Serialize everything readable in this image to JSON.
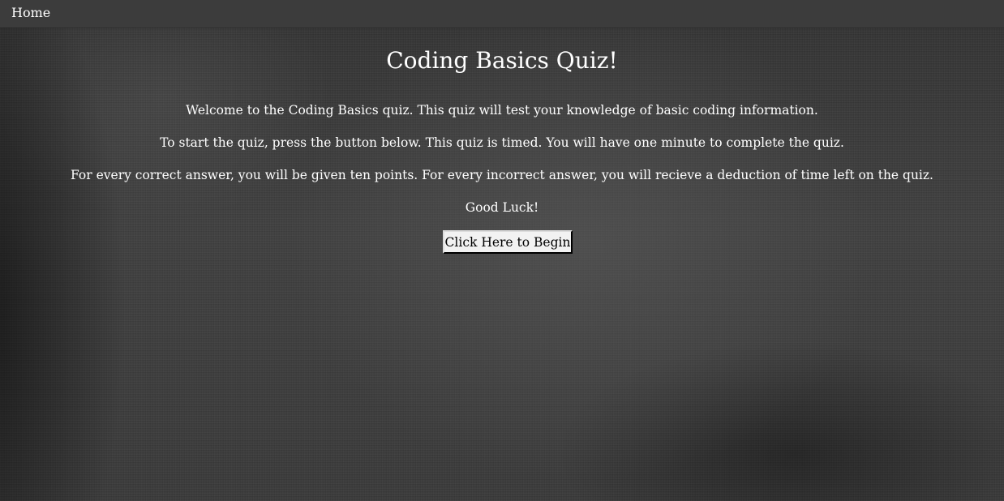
{
  "nav": {
    "home_label": "Home"
  },
  "quiz": {
    "title": "Coding Basics Quiz!",
    "paragraphs": [
      "Welcome to the Coding Basics quiz. This quiz will test your knowledge of basic coding information.",
      "To start the quiz, press the button below. This quiz is timed. You will have one minute to complete the quiz.",
      "For every correct answer, you will be given ten points. For every incorrect answer, you will recieve a deduction of time left on the quiz.",
      "Good Luck!"
    ],
    "start_button_label": "Click Here to Begin"
  },
  "colors": {
    "navbar": "#3c3c3c",
    "background": "#3b3b3b",
    "text": "#ffffff",
    "button_bg": "#f2f2f2"
  }
}
